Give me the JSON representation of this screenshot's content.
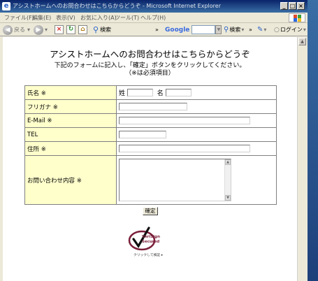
{
  "window": {
    "title": "アシストホームへのお問合わせはこちらからどうぞ - Microsoft Internet Explorer",
    "buttons": [
      "_",
      "□",
      "×"
    ]
  },
  "menubar": [
    "ファイル(F)",
    "編集(E)",
    "表示(V)",
    "お気に入り(A)",
    "ツール(T)",
    "ヘルプ(H)"
  ],
  "toolbar": {
    "back_label": "戻る",
    "search_label": "検索",
    "google_label": "Google",
    "search2_label": "検索",
    "login_label": "ログイン"
  },
  "page": {
    "title": "アシストホームへのお問合わせはこちらからどうぞ",
    "instruction_line1": "下記のフォームに記入し、「確定」ボタンをクリックしてください。",
    "instruction_line2": "（※は必須項目）"
  },
  "form": {
    "name_label": "氏名 ※",
    "sei_label": "姓",
    "mei_label": "名",
    "furigana_label": "フリガナ ※",
    "email_label": "E-Mail ※",
    "tel_label": "TEL",
    "address_label": "住所 ※",
    "inquiry_label": "お問い合わせ内容 ※",
    "submit_label": "確定"
  },
  "seal": {
    "line1": "VeriSign",
    "line2": "Secured",
    "caption": "クリックして検証 ▸"
  },
  "colors": {
    "label_bg": "#ffffcc",
    "titlebar": "#0a246a",
    "seal": "#7b1f3a"
  }
}
